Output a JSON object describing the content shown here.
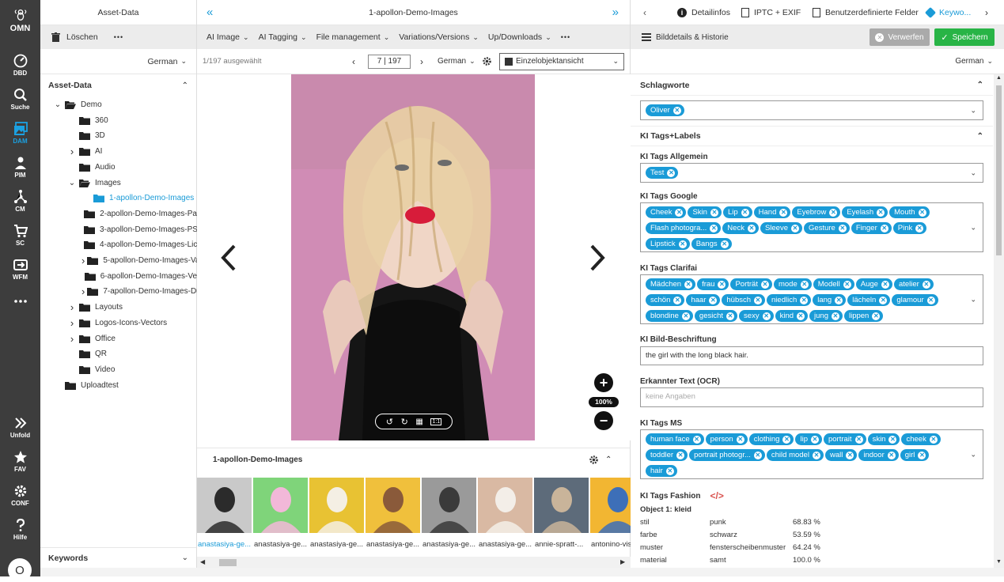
{
  "rail": {
    "logo": "OMN",
    "items": [
      {
        "label": "DBD",
        "icon": "dashboard-icon"
      },
      {
        "label": "Suche",
        "icon": "search-icon"
      },
      {
        "label": "DAM",
        "icon": "dam-icon",
        "active": true
      },
      {
        "label": "PIM",
        "icon": "pim-icon"
      },
      {
        "label": "CM",
        "icon": "cm-icon"
      },
      {
        "label": "SC",
        "icon": "cart-icon"
      },
      {
        "label": "WFM",
        "icon": "workflow-icon"
      },
      {
        "label": "",
        "icon": "more-icon"
      }
    ],
    "bottom": [
      {
        "label": "Unfold",
        "icon": "unfold-icon"
      },
      {
        "label": "FAV",
        "icon": "star-icon"
      },
      {
        "label": "CONF",
        "icon": "gear-icon"
      },
      {
        "label": "Hilfe",
        "icon": "help-icon"
      }
    ],
    "avatar": "O"
  },
  "left": {
    "title": "Asset-Data",
    "delete_label": "Löschen",
    "more": "•••",
    "language": "German",
    "section_title": "Asset-Data",
    "tree": [
      {
        "label": "Demo",
        "level": 0,
        "caret": "down",
        "open": true
      },
      {
        "label": "360",
        "level": 1,
        "caret": ""
      },
      {
        "label": "3D",
        "level": 1,
        "caret": ""
      },
      {
        "label": "AI",
        "level": 1,
        "caret": "right"
      },
      {
        "label": "Audio",
        "level": 1,
        "caret": ""
      },
      {
        "label": "Images",
        "level": 1,
        "caret": "down",
        "open": true
      },
      {
        "label": "1-apollon-Demo-Images",
        "level": 2,
        "caret": "",
        "selected": true
      },
      {
        "label": "2-apollon-Demo-Images-Pa",
        "level": 2,
        "caret": ""
      },
      {
        "label": "3-apollon-Demo-Images-PS",
        "level": 2,
        "caret": ""
      },
      {
        "label": "4-apollon-Demo-Images-Lic",
        "level": 2,
        "caret": ""
      },
      {
        "label": "5-apollon-Demo-Images-Va",
        "level": 2,
        "caret": "right"
      },
      {
        "label": "6-apollon-Demo-Images-Ve",
        "level": 2,
        "caret": ""
      },
      {
        "label": "7-apollon-Demo-Images-Du",
        "level": 2,
        "caret": "right"
      },
      {
        "label": "Layouts",
        "level": 1,
        "caret": "right"
      },
      {
        "label": "Logos-Icons-Vectors",
        "level": 1,
        "caret": "right"
      },
      {
        "label": "Office",
        "level": 1,
        "caret": "right"
      },
      {
        "label": "QR",
        "level": 1,
        "caret": ""
      },
      {
        "label": "Video",
        "level": 1,
        "caret": ""
      },
      {
        "label": "Uploadtest",
        "level": 0,
        "caret": ""
      }
    ],
    "keywords_label": "Keywords"
  },
  "center": {
    "title": "1-apollon-Demo-Images",
    "menu": [
      "AI Image",
      "AI Tagging",
      "File management",
      "Variations/Versions",
      "Up/Downloads"
    ],
    "more": "•••",
    "selected_count": "1/197 ausgewählt",
    "page": "7 | 197",
    "language": "German",
    "view_mode": "Einzelobjektansicht",
    "zoom": "100%",
    "one_to_one": "1:1",
    "strip_title": "1-apollon-Demo-Images",
    "thumbs": [
      {
        "caption": "anastasiya-ge...",
        "selected": true,
        "bg": "#c9c9c9",
        "fg": "#2b2b2b"
      },
      {
        "caption": "anastasiya-ge...",
        "bg": "#7fd47a",
        "fg": "#f2b8d8"
      },
      {
        "caption": "anastasiya-ge...",
        "bg": "#e8c233",
        "fg": "#f4efe4"
      },
      {
        "caption": "anastasiya-ge...",
        "bg": "#f0c03c",
        "fg": "#8a5a3a"
      },
      {
        "caption": "anastasiya-ge...",
        "bg": "#9a9a9a",
        "fg": "#3a3a3a"
      },
      {
        "caption": "anastasiya-ge...",
        "bg": "#d9b9a3",
        "fg": "#f3eee8"
      },
      {
        "caption": "annie-spratt-...",
        "bg": "#5d6b7a",
        "fg": "#c9b49a"
      },
      {
        "caption": "antonino-visa",
        "bg": "#f2b632",
        "fg": "#3d6fb8"
      }
    ]
  },
  "right": {
    "tabs": [
      "Detailinfos",
      "IPTC + EXIF",
      "Benutzerdefinierte Felder",
      "Keywo..."
    ],
    "history_label": "Bilddetails & Historie",
    "discard_label": "Verwerfen",
    "save_label": "Speichern",
    "language": "German",
    "schlagworte_title": "Schlagworte",
    "schlagworte": [
      "Oliver"
    ],
    "ki_title": "KI Tags+Labels",
    "allgemein_label": "KI Tags Allgemein",
    "allgemein": [
      "Test"
    ],
    "google_label": "KI Tags Google",
    "google": [
      "Cheek",
      "Skin",
      "Lip",
      "Hand",
      "Eyebrow",
      "Eyelash",
      "Mouth",
      "Flash photogra...",
      "Neck",
      "Sleeve",
      "Gesture",
      "Finger",
      "Pink",
      "Lipstick",
      "Bangs"
    ],
    "clarifai_label": "KI Tags Clarifai",
    "clarifai": [
      "Mädchen",
      "frau",
      "Porträt",
      "mode",
      "Modell",
      "Auge",
      "atelier",
      "schön",
      "haar",
      "hübsch",
      "niedlich",
      "lang",
      "lächeln",
      "glamour",
      "blondine",
      "gesicht",
      "sexy",
      "kind",
      "jung",
      "lippen"
    ],
    "caption_label": "KI Bild-Beschriftung",
    "caption_value": "the girl with the long black hair.",
    "ocr_label": "Erkannter Text (OCR)",
    "ocr_placeholder": "keine Angaben",
    "ms_label": "KI Tags MS",
    "ms": [
      "human face",
      "person",
      "clothing",
      "lip",
      "portrait",
      "skin",
      "cheek",
      "toddler",
      "portrait photogr...",
      "child model",
      "wall",
      "indoor",
      "girl",
      "hair"
    ],
    "fashion_label": "KI Tags Fashion",
    "fashion_object": "Object 1: kleid",
    "fashion_rows": [
      {
        "key": "stil",
        "value": "punk",
        "pct": "68.83 %"
      },
      {
        "key": "farbe",
        "value": "schwarz",
        "pct": "53.59 %"
      },
      {
        "key": "muster",
        "value": "fensterscheibenmuster",
        "pct": "64.24 %"
      },
      {
        "key": "material",
        "value": "samt",
        "pct": "100.0 %"
      }
    ]
  },
  "colors": {
    "accent": "#1a9bd7",
    "save": "#28b446",
    "rail": "#3d3d3d",
    "folder": "#222222"
  }
}
